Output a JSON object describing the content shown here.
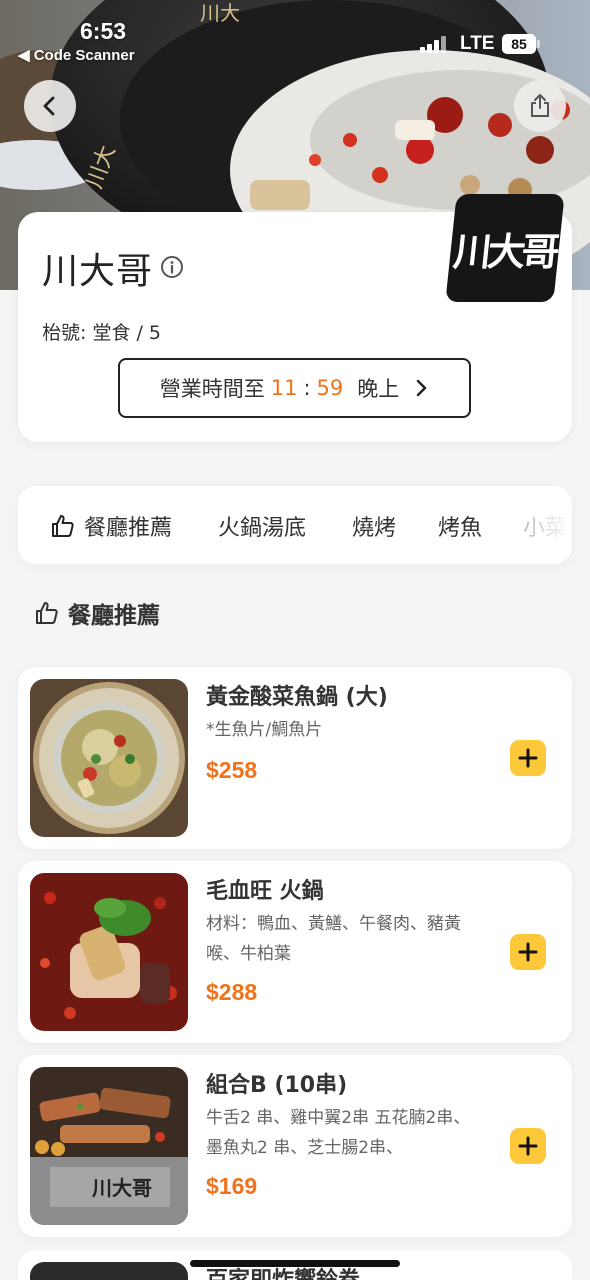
{
  "status_bar": {
    "time": "6:53",
    "back_to_app": "◀ Code Scanner",
    "carrier": "LTE",
    "battery": "85"
  },
  "header": {
    "back_icon": "chevron-left-icon",
    "share_icon": "share-icon"
  },
  "restaurant": {
    "name": "川大哥",
    "logo_text": "川大哥",
    "table_label": "枱號: 堂食 / 5",
    "hours_prefix": "營業時間至",
    "hours_hour": "11",
    "hours_sep": ":",
    "hours_min": "59",
    "hours_suffix": "晚上"
  },
  "tabs": [
    {
      "label": "餐廳推薦",
      "icon": "thumbs-up-icon"
    },
    {
      "label": "火鍋湯底"
    },
    {
      "label": "燒烤"
    },
    {
      "label": "烤魚"
    },
    {
      "label": "小菜"
    }
  ],
  "section": {
    "title": "餐廳推薦",
    "icon": "thumbs-up-icon"
  },
  "dishes": [
    {
      "name": "黃金酸菜魚鍋 (大)",
      "desc": "*生魚片/鯛魚片",
      "price": "$258"
    },
    {
      "name": "毛血旺 火鍋",
      "desc": "材料：鴨血、黃鱔、午餐肉、豬黃喉、牛柏葉",
      "price": "$288"
    },
    {
      "name": "組合B (10串)",
      "desc": "牛舌2 串、雞中翼2串 五花腩2串、墨魚丸2 串、芝士腸2串、",
      "price": "$169"
    },
    {
      "name": "百家即炸響鈴卷"
    }
  ],
  "colors": {
    "accent_orange": "#f0731c",
    "add_button_yellow": "#fdc93a",
    "background": "#f4f4f5"
  }
}
